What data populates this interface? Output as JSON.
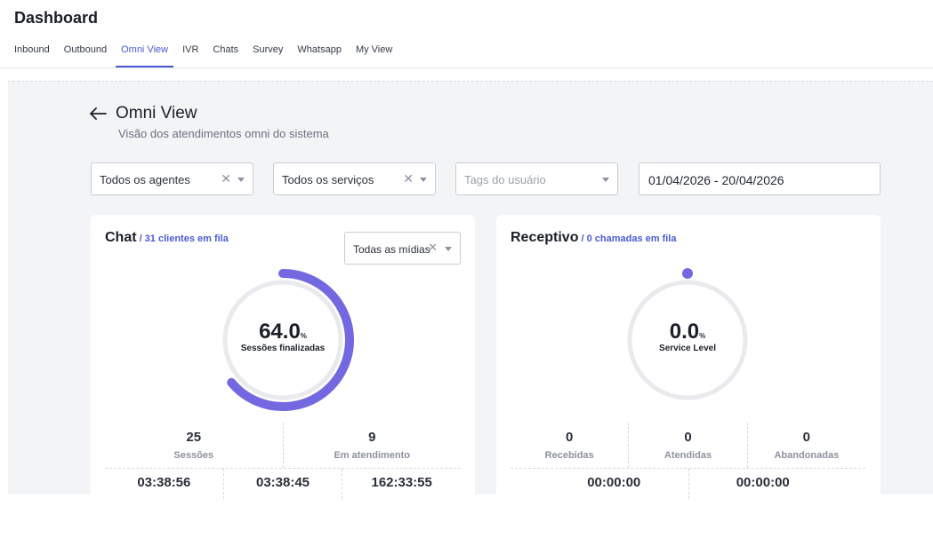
{
  "header": {
    "title": "Dashboard",
    "tabs": [
      {
        "label": "Inbound"
      },
      {
        "label": "Outbound"
      },
      {
        "label": "Omni View"
      },
      {
        "label": "IVR"
      },
      {
        "label": "Chats"
      },
      {
        "label": "Survey"
      },
      {
        "label": "Whatsapp"
      },
      {
        "label": "My View"
      }
    ],
    "active_tab": "Omni View"
  },
  "section": {
    "title": "Omni View",
    "subtitle": "Visão dos atendimentos omni do sistema"
  },
  "filters": {
    "agents": "Todos os agentes",
    "services": "Todos os serviços",
    "tags_placeholder": "Tags do usuário",
    "date_range": "01/04/2026 - 20/04/2026"
  },
  "chat_card": {
    "title": "Chat",
    "queue": "/ 31 clientes em fila",
    "media_select": "Todas as mídias",
    "gauge_value": "64.0",
    "gauge_unit": "%",
    "gauge_label": "Sessões finalizadas",
    "gauge_percent": 64.0,
    "stats": [
      {
        "value": "25",
        "label": "Sessões"
      },
      {
        "value": "9",
        "label": "Em atendimento"
      }
    ],
    "times": [
      "03:38:56",
      "03:38:45",
      "162:33:55"
    ]
  },
  "receptivo_card": {
    "title": "Receptivo",
    "queue": "/ 0 chamadas em fila",
    "gauge_value": "0.0",
    "gauge_unit": "%",
    "gauge_label": "Service Level",
    "gauge_percent": 0.0,
    "stats": [
      {
        "value": "0",
        "label": "Recebidas"
      },
      {
        "value": "0",
        "label": "Atendidas"
      },
      {
        "value": "0",
        "label": "Abandonadas"
      }
    ],
    "times": [
      "00:00:00",
      "00:00:00"
    ]
  },
  "colors": {
    "accent": "#4a5bd4",
    "gauge_fill": "#7468e0",
    "gauge_track": "#e8eaee"
  }
}
